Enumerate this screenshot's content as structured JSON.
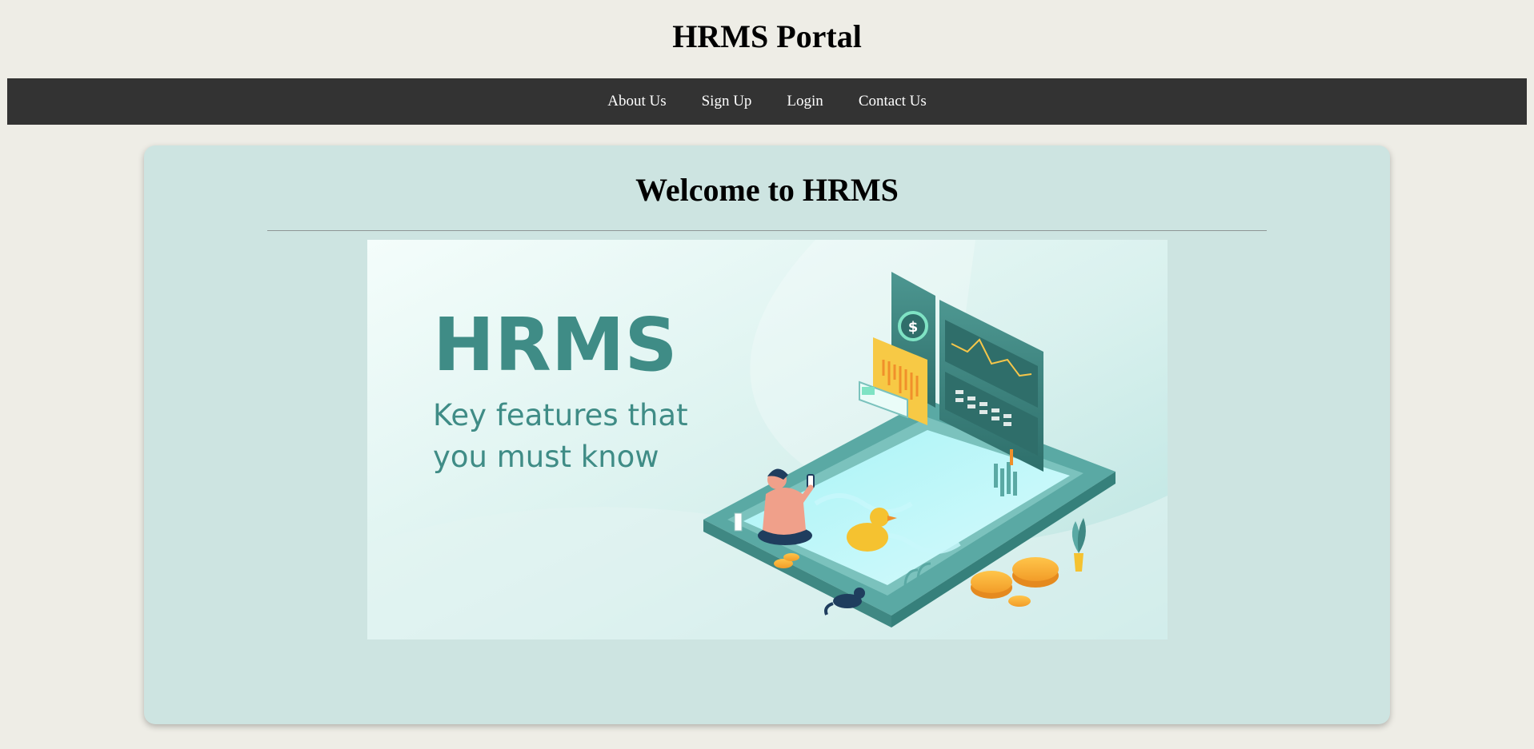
{
  "header": {
    "title": "HRMS Portal"
  },
  "nav": {
    "items": [
      {
        "label": "About Us"
      },
      {
        "label": "Sign Up"
      },
      {
        "label": "Login"
      },
      {
        "label": "Contact Us"
      }
    ]
  },
  "main": {
    "heading": "Welcome to HRMS",
    "banner": {
      "title": "HRMS",
      "line1": "Key features that",
      "line2": "you must know",
      "illustration": "isometric-pool-dashboard-illustration"
    }
  },
  "colors": {
    "page_bg": "#eeede6",
    "nav_bg": "#333333",
    "card_bg": "#cde4e1",
    "banner_accent": "#3f8c86"
  }
}
